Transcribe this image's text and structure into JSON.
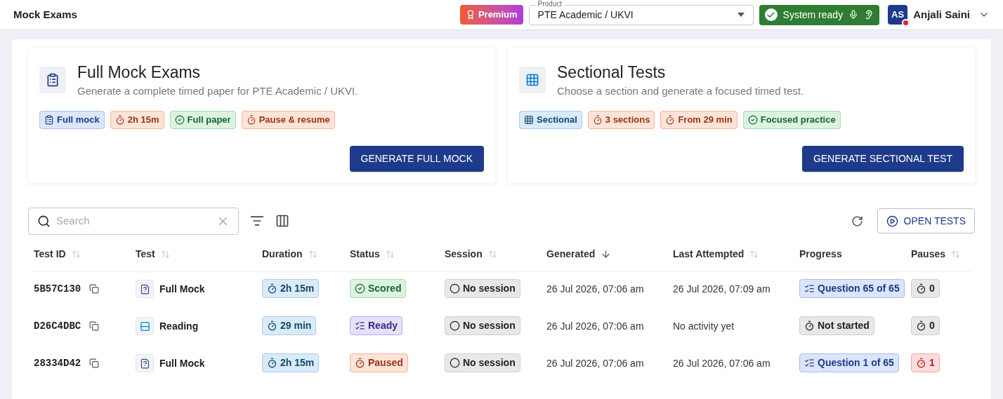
{
  "header": {
    "title": "Mock Exams",
    "premium": "Premium",
    "product": {
      "label": "Product",
      "value": "PTE Academic / UKVI"
    },
    "system": {
      "label": "System ready"
    },
    "user": {
      "initials": "AS",
      "name": "Anjali Saini"
    }
  },
  "cards": [
    {
      "kind": "full",
      "title": "Full Mock Exams",
      "subtitle": "Generate a complete timed paper for PTE Academic / UKVI.",
      "chips": [
        {
          "kind": "mock",
          "label": "Full mock"
        },
        {
          "kind": "timer",
          "label": "2h 15m"
        },
        {
          "kind": "check",
          "label": "Full paper"
        },
        {
          "kind": "timer",
          "label": "Pause & resume"
        }
      ],
      "button": "GENERATE FULL MOCK"
    },
    {
      "kind": "sectional",
      "title": "Sectional Tests",
      "subtitle": "Choose a section and generate a focused timed test.",
      "chips": [
        {
          "kind": "sectional",
          "label": "Sectional"
        },
        {
          "kind": "timer",
          "label": "3 sections"
        },
        {
          "kind": "timer",
          "label": "From 29 min"
        },
        {
          "kind": "check",
          "label": "Focused practice"
        }
      ],
      "button": "GENERATE SECTIONAL TEST"
    }
  ],
  "toolbar": {
    "search_placeholder": "Search",
    "open_button": "OPEN TESTS"
  },
  "table": {
    "columns": [
      {
        "label": "Test ID",
        "kind": "sortable"
      },
      {
        "label": "Test",
        "kind": "sortable"
      },
      {
        "label": "Duration",
        "kind": "sortable"
      },
      {
        "label": "Status",
        "kind": "sortable"
      },
      {
        "label": "Session",
        "kind": "sortable"
      },
      {
        "label": "Generated",
        "kind": "sorted"
      },
      {
        "label": "Last Attempted",
        "kind": "sortable"
      },
      {
        "label": "Progress",
        "kind": "plain"
      },
      {
        "label": "Pauses",
        "kind": "sortable"
      }
    ],
    "rows": [
      {
        "id": "5B57C130",
        "test": {
          "kind": "full",
          "label": "Full Mock"
        },
        "duration": "2h 15m",
        "status": {
          "kind": "scored",
          "label": "Scored"
        },
        "session": "No session",
        "generated": "26 Jul 2026, 07:06 am",
        "last_attempted": "26 Jul 2026, 07:09 am",
        "progress": {
          "kind": "question",
          "label": "Question 65 of 65"
        },
        "pauses": {
          "kind": "zero",
          "label": "0"
        }
      },
      {
        "id": "D26C4DBC",
        "test": {
          "kind": "reading",
          "label": "Reading"
        },
        "duration": "29 min",
        "status": {
          "kind": "ready",
          "label": "Ready"
        },
        "session": "No session",
        "generated": "26 Jul 2026, 07:06 am",
        "last_attempted": "No activity yet",
        "progress": {
          "kind": "not_started",
          "label": "Not started"
        },
        "pauses": {
          "kind": "zero",
          "label": "0"
        }
      },
      {
        "id": "28334D42",
        "test": {
          "kind": "full",
          "label": "Full Mock"
        },
        "duration": "2h 15m",
        "status": {
          "kind": "paused",
          "label": "Paused"
        },
        "session": "No session",
        "generated": "26 Jul 2026, 07:06 am",
        "last_attempted": "26 Jul 2026, 07:06 am",
        "progress": {
          "kind": "question",
          "label": "Question 1 of 65"
        },
        "pauses": {
          "kind": "some",
          "label": "1"
        }
      }
    ]
  }
}
